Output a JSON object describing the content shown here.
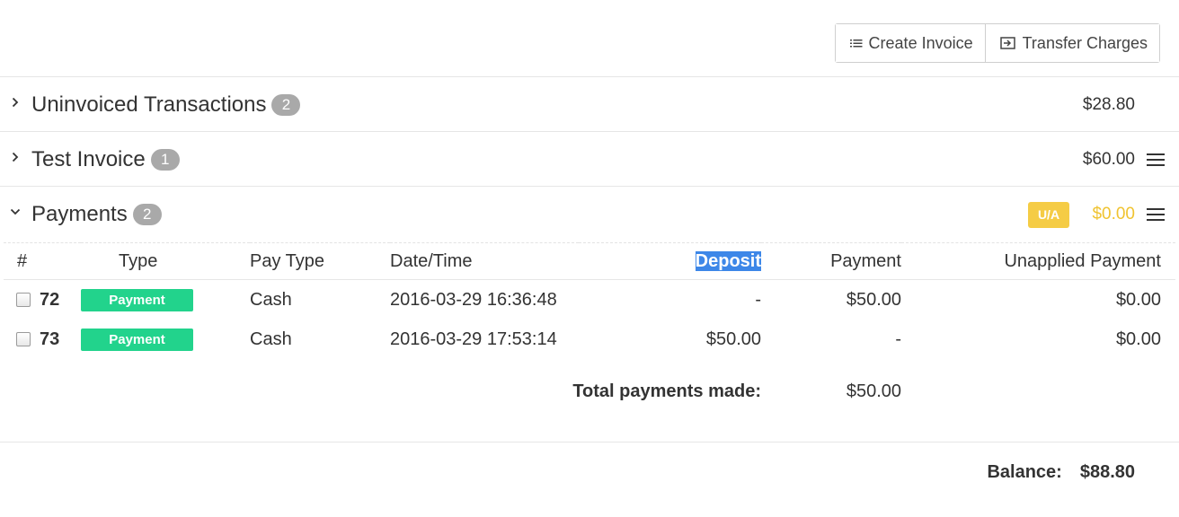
{
  "toolbar": {
    "create_invoice": "Create Invoice",
    "create_invoice_icon": "list-icon",
    "transfer_charges": "Transfer Charges",
    "transfer_charges_icon": "transfer-icon"
  },
  "sections": [
    {
      "title": "Uninvoiced Transactions",
      "count": "2",
      "amount": "$28.80",
      "expanded": false,
      "has_menu": false
    },
    {
      "title": "Test Invoice",
      "count": "1",
      "amount": "$60.00",
      "expanded": false,
      "has_menu": true
    },
    {
      "title": "Payments",
      "count": "2",
      "amount": "$0.00",
      "expanded": true,
      "has_menu": true,
      "status_badge": "U/A",
      "amount_color": "#f0c330",
      "badge_color": "#f5cc45"
    }
  ],
  "payments_table": {
    "headers": [
      "#",
      "Type",
      "Pay Type",
      "Date/Time",
      "Deposit",
      "Payment",
      "Unapplied Payment"
    ],
    "rows": [
      {
        "id": "72",
        "type": "Payment",
        "pay_type": "Cash",
        "datetime": "2016-03-29 16:36:48",
        "deposit": "-",
        "payment": "$50.00",
        "unapplied": "$0.00"
      },
      {
        "id": "73",
        "type": "Payment",
        "pay_type": "Cash",
        "datetime": "2016-03-29 17:53:14",
        "deposit": "$50.00",
        "payment": "-",
        "unapplied": "$0.00"
      }
    ],
    "total_label": "Total payments made:",
    "total_value": "$50.00",
    "type_badge_color": "#22d38c",
    "highlight_color": "#3d87e8"
  },
  "balance": {
    "label": "Balance:",
    "value": "$88.80"
  }
}
